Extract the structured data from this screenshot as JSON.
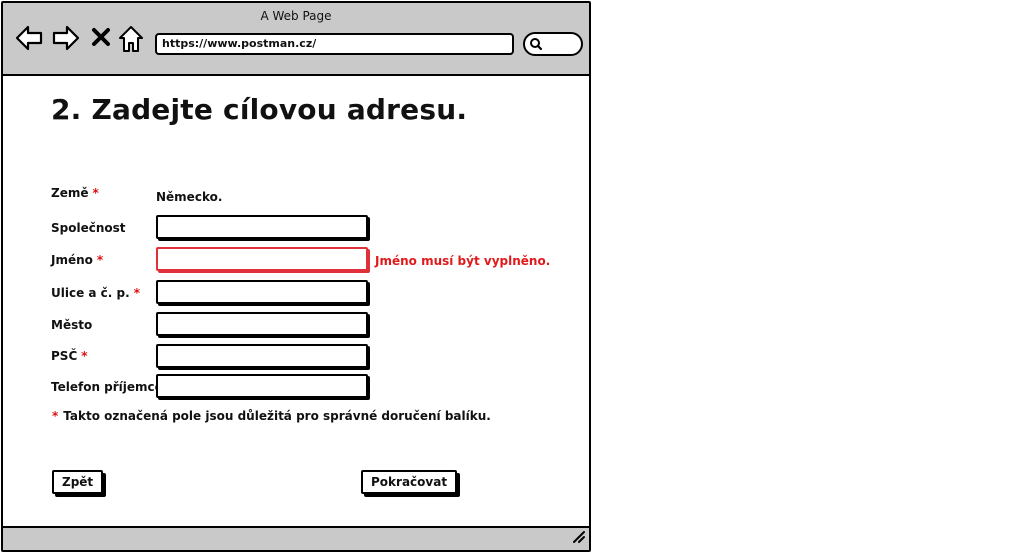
{
  "window": {
    "title": "A Web Page"
  },
  "toolbar": {
    "back_icon": "back-arrow-icon",
    "forward_icon": "forward-arrow-icon",
    "stop_icon": "close-icon",
    "home_icon": "home-icon",
    "url": "https://www.postman.cz/",
    "search_icon": "search-icon"
  },
  "page": {
    "title": "2. Zadejte cílovou adresu."
  },
  "form": {
    "required_marker": "*",
    "country": {
      "label": "Země",
      "value": "Německo."
    },
    "company": {
      "label": "Společnost",
      "value": ""
    },
    "name": {
      "label": "Jméno",
      "value": "",
      "error": "Jméno musí být vyplněno."
    },
    "street": {
      "label": "Ulice a č. p.",
      "value": ""
    },
    "city": {
      "label": "Město",
      "value": ""
    },
    "zip": {
      "label": "PSČ",
      "value": ""
    },
    "phone": {
      "label": "Telefon příjemce",
      "value": ""
    },
    "note": "Takto označená pole jsou důležitá pro správné doručení balíku."
  },
  "buttons": {
    "back": "Zpět",
    "continue": "Pokračovat"
  },
  "colors": {
    "chrome": "#c9c9c9",
    "error": "#e01a1a",
    "required": "#dd1111"
  }
}
